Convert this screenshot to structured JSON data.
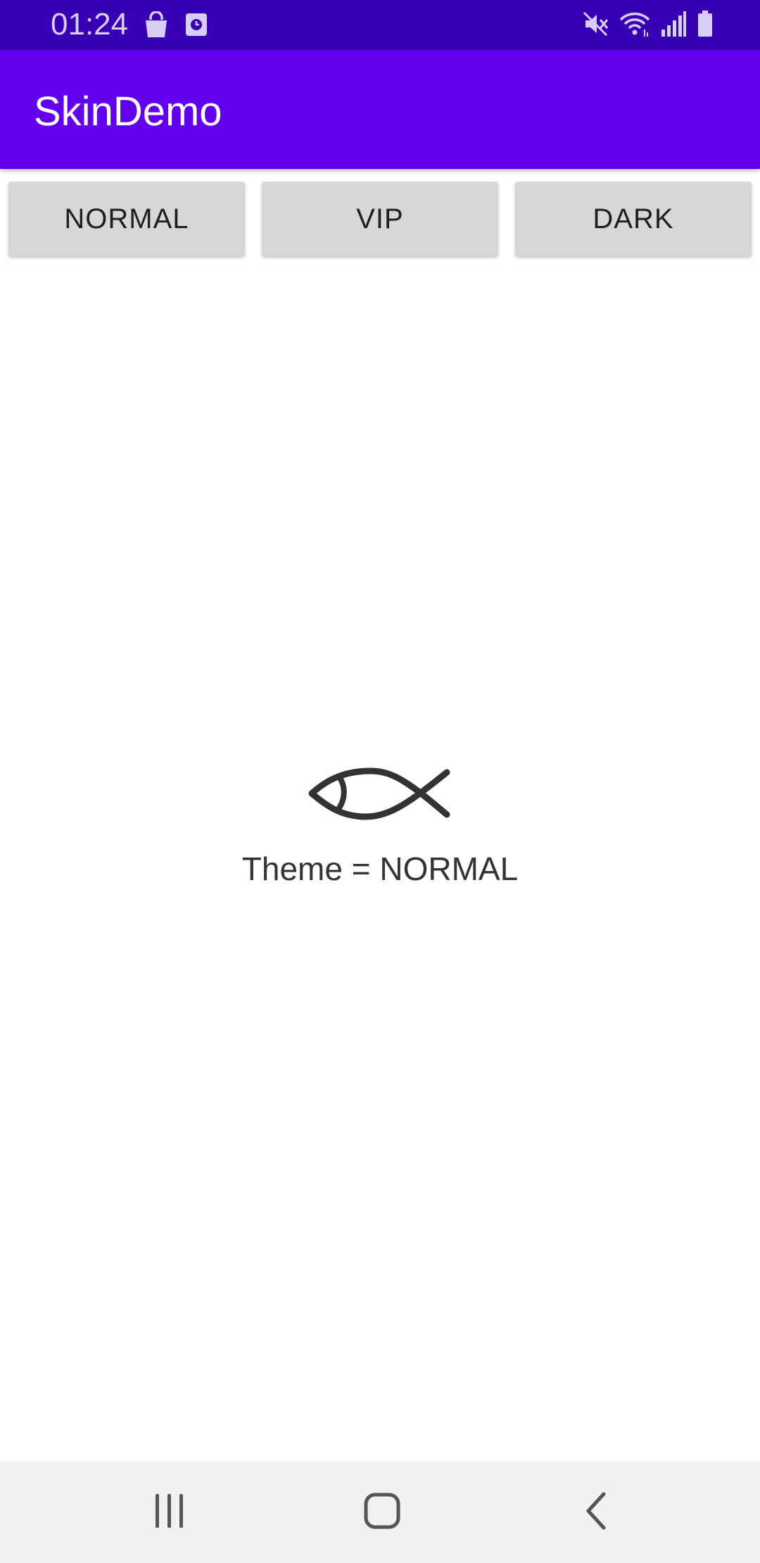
{
  "status_bar": {
    "time": "01:24",
    "left_icons": [
      "shopping-bag-icon",
      "clock-app-icon"
    ],
    "right_icons": [
      "mute-icon",
      "wifi-icon",
      "signal-icon",
      "battery-icon"
    ]
  },
  "app_bar": {
    "title": "SkinDemo"
  },
  "buttons": [
    {
      "label": "NORMAL"
    },
    {
      "label": "VIP"
    },
    {
      "label": "DARK"
    }
  ],
  "content": {
    "icon": "fish-icon",
    "theme_text": "Theme = NORMAL"
  },
  "nav_bar": {
    "buttons": [
      "recent-apps-icon",
      "home-icon",
      "back-icon"
    ]
  },
  "colors": {
    "status_bar": "#3700b3",
    "app_bar": "#6200ee",
    "button_bg": "#d6d7d7",
    "nav_bar": "#f1f1f1"
  }
}
